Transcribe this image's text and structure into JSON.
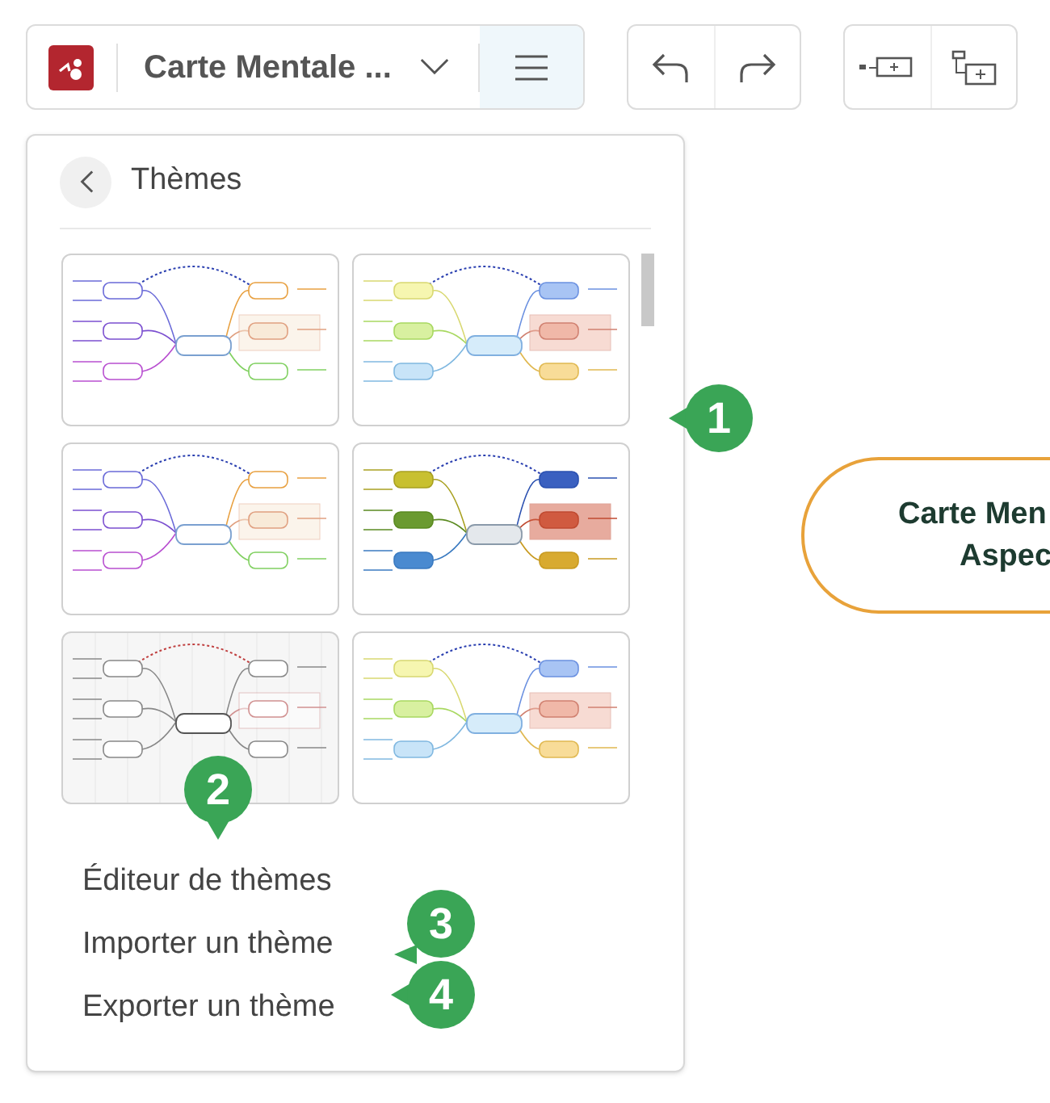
{
  "toolbar": {
    "title": "Carte Mentale ...",
    "menu_expanded": true
  },
  "themes_menu": {
    "title": "Thèmes",
    "themes": [
      {
        "kind": "outline"
      },
      {
        "kind": "pastel"
      },
      {
        "kind": "outline"
      },
      {
        "kind": "bold"
      },
      {
        "kind": "sketch"
      },
      {
        "kind": "pastel"
      }
    ],
    "items": [
      "Éditeur de thèmes",
      "Importer un thème",
      "Exporter un thème"
    ]
  },
  "callouts": [
    {
      "label": "1",
      "kind": "left"
    },
    {
      "label": "2",
      "kind": "down"
    },
    {
      "label": "3",
      "kind": "downleft"
    },
    {
      "label": "4",
      "kind": "left"
    }
  ],
  "canvas": {
    "central_node": {
      "lines": [
        "Carte Men",
        "Aspec"
      ]
    }
  }
}
